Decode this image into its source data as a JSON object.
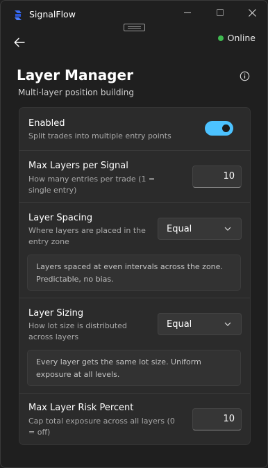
{
  "app": {
    "title": "SignalFlow"
  },
  "status": {
    "label": "Online",
    "color": "#3fb950"
  },
  "page": {
    "title": "Layer Manager",
    "subtitle": "Multi-layer position building"
  },
  "settings": {
    "enabled": {
      "title": "Enabled",
      "desc": "Split trades into multiple entry points",
      "on": true
    },
    "max_layers": {
      "title": "Max Layers per Signal",
      "desc": "How many entries per trade (1 = single entry)",
      "value": "10"
    },
    "spacing": {
      "title": "Layer Spacing",
      "desc": "Where layers are placed in the entry zone",
      "value": "Equal",
      "info": "Layers spaced at even intervals across the zone. Predictable, no bias."
    },
    "sizing": {
      "title": "Layer Sizing",
      "desc": "How lot size is distributed across layers",
      "value": "Equal",
      "info": "Every layer gets the same lot size. Uniform exposure at all levels."
    },
    "max_risk": {
      "title": "Max Layer Risk Percent",
      "desc": "Cap total exposure across all layers (0 = off)",
      "value": "10"
    }
  },
  "colors": {
    "accent": "#4cc2ff",
    "background": "#1f1f1f",
    "card": "#2b2b2b"
  }
}
